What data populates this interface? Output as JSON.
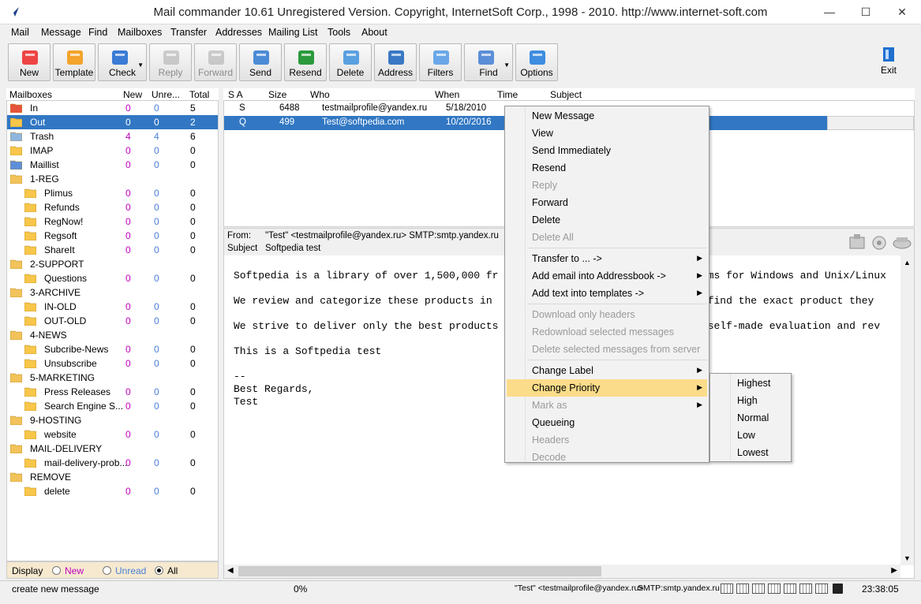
{
  "window": {
    "title": "Mail commander 10.61 Unregistered Version. Copyright, InternetSoft Corp., 1998 - 2010. http://www.internet-soft.com",
    "minimize": "—",
    "maximize": "☐",
    "close": "✕"
  },
  "menu": [
    "Mail",
    "Message",
    "Find",
    "Mailboxes",
    "Transfer",
    "Addresses",
    "Mailing List",
    "Tools",
    "About"
  ],
  "toolbar": [
    {
      "label": "New",
      "icon": "new-icon",
      "enabled": true
    },
    {
      "label": "Template",
      "icon": "template-icon",
      "enabled": true
    },
    {
      "label": "Check",
      "icon": "check-icon",
      "enabled": true
    },
    {
      "label": "Reply",
      "icon": "reply-icon",
      "enabled": false
    },
    {
      "label": "Forward",
      "icon": "forward-icon",
      "enabled": false
    },
    {
      "label": "Send",
      "icon": "send-icon",
      "enabled": true
    },
    {
      "label": "Resend",
      "icon": "resend-icon",
      "enabled": true
    },
    {
      "label": "Delete",
      "icon": "delete-icon",
      "enabled": true
    },
    {
      "label": "Address",
      "icon": "address-icon",
      "enabled": true
    },
    {
      "label": "Filters",
      "icon": "filters-icon",
      "enabled": true
    },
    {
      "label": "Find",
      "icon": "find-icon",
      "enabled": true
    },
    {
      "label": "Options",
      "icon": "options-icon",
      "enabled": true
    }
  ],
  "exit_label": "Exit",
  "mailbox_columns": [
    "Mailboxes",
    "New",
    "Unre...",
    "Total"
  ],
  "mailboxes": [
    {
      "name": "In",
      "new": "0",
      "unread": "0",
      "total": "5",
      "level": 0,
      "type": "in"
    },
    {
      "name": "Out",
      "new": "0",
      "unread": "0",
      "total": "2",
      "level": 0,
      "type": "out",
      "selected": true
    },
    {
      "name": "Trash",
      "new": "4",
      "unread": "4",
      "total": "6",
      "level": 0,
      "type": "trash"
    },
    {
      "name": "IMAP",
      "new": "0",
      "unread": "0",
      "total": "0",
      "level": 0,
      "type": "imap"
    },
    {
      "name": "Maillist",
      "new": "0",
      "unread": "0",
      "total": "0",
      "level": 0,
      "type": "maillist"
    },
    {
      "name": "1-REG",
      "new": "",
      "unread": "",
      "total": "",
      "level": 0,
      "type": "folder"
    },
    {
      "name": "Plimus",
      "new": "0",
      "unread": "0",
      "total": "0",
      "level": 1,
      "type": "box"
    },
    {
      "name": "Refunds",
      "new": "0",
      "unread": "0",
      "total": "0",
      "level": 1,
      "type": "box"
    },
    {
      "name": "RegNow!",
      "new": "0",
      "unread": "0",
      "total": "0",
      "level": 1,
      "type": "box"
    },
    {
      "name": "Regsoft",
      "new": "0",
      "unread": "0",
      "total": "0",
      "level": 1,
      "type": "box"
    },
    {
      "name": "ShareIt",
      "new": "0",
      "unread": "0",
      "total": "0",
      "level": 1,
      "type": "box"
    },
    {
      "name": "2-SUPPORT",
      "new": "",
      "unread": "",
      "total": "",
      "level": 0,
      "type": "folder"
    },
    {
      "name": "Questions",
      "new": "0",
      "unread": "0",
      "total": "0",
      "level": 1,
      "type": "box"
    },
    {
      "name": "3-ARCHIVE",
      "new": "",
      "unread": "",
      "total": "",
      "level": 0,
      "type": "folder"
    },
    {
      "name": "IN-OLD",
      "new": "0",
      "unread": "0",
      "total": "0",
      "level": 1,
      "type": "box"
    },
    {
      "name": "OUT-OLD",
      "new": "0",
      "unread": "0",
      "total": "0",
      "level": 1,
      "type": "box"
    },
    {
      "name": "4-NEWS",
      "new": "",
      "unread": "",
      "total": "",
      "level": 0,
      "type": "folder"
    },
    {
      "name": "Subcribe-News",
      "new": "0",
      "unread": "0",
      "total": "0",
      "level": 1,
      "type": "box"
    },
    {
      "name": "Unsubscribe",
      "new": "0",
      "unread": "0",
      "total": "0",
      "level": 1,
      "type": "box"
    },
    {
      "name": "5-MARKETING",
      "new": "",
      "unread": "",
      "total": "",
      "level": 0,
      "type": "folder"
    },
    {
      "name": "Press Releases",
      "new": "0",
      "unread": "0",
      "total": "0",
      "level": 1,
      "type": "box"
    },
    {
      "name": "Search Engine S...",
      "new": "0",
      "unread": "0",
      "total": "0",
      "level": 1,
      "type": "box"
    },
    {
      "name": "9-HOSTING",
      "new": "",
      "unread": "",
      "total": "",
      "level": 0,
      "type": "folder"
    },
    {
      "name": "website",
      "new": "0",
      "unread": "0",
      "total": "0",
      "level": 1,
      "type": "box"
    },
    {
      "name": "MAIL-DELIVERY",
      "new": "",
      "unread": "",
      "total": "",
      "level": 0,
      "type": "folder"
    },
    {
      "name": "mail-delivery-prob...",
      "new": "0",
      "unread": "0",
      "total": "0",
      "level": 1,
      "type": "box"
    },
    {
      "name": "REMOVE",
      "new": "",
      "unread": "",
      "total": "",
      "level": 0,
      "type": "folder"
    },
    {
      "name": "delete",
      "new": "0",
      "unread": "0",
      "total": "0",
      "level": 1,
      "type": "box"
    }
  ],
  "display": {
    "label": "Display",
    "new": "New",
    "unread": "Unread",
    "all": "All",
    "selected": "all"
  },
  "message_columns": [
    "S A",
    "Size",
    "Who",
    "When",
    "Time",
    "Subject"
  ],
  "messages": [
    {
      "sa": "S",
      "size": "6488",
      "who": "testmailprofile@yandex.ru",
      "when": "5/18/2010",
      "time": "",
      "subject": "",
      "selected": false
    },
    {
      "sa": "Q",
      "size": "499",
      "who": "Test@softpedia.com",
      "when": "10/20/2016",
      "time": "",
      "subject": "",
      "selected": true
    }
  ],
  "preview": {
    "from_label": "From:",
    "from_value": "\"Test\" <testmailprofile@yandex.ru>  SMTP:smtp.yandex.ru",
    "subject_label": "Subject",
    "subject_value": "Softpedia test",
    "body_lines": [
      "Softpedia is a library of over 1,500,000 fr                                 ams for Windows and Unix/Linux",
      "",
      "We review and categorize these products in                                 o find the exact product they",
      "",
      "We strive to deliver only the best products                                h self-made evaluation and rev",
      "",
      "This is a Softpedia test",
      "",
      "--",
      "Best Regards,",
      "Test"
    ]
  },
  "status": {
    "hint": "create new message",
    "progress": "0%",
    "account": "\"Test\" <testmailprofile@yandex.ru>",
    "smtp": "SMTP:smtp.yandex.ru",
    "clock": "23:38:05"
  },
  "context_menu": [
    {
      "label": "New Message",
      "enabled": true
    },
    {
      "label": "View",
      "enabled": true
    },
    {
      "label": "Send Immediately",
      "enabled": true
    },
    {
      "label": "Resend",
      "enabled": true
    },
    {
      "label": "Reply",
      "enabled": false
    },
    {
      "label": "Forward",
      "enabled": true
    },
    {
      "label": "Delete",
      "enabled": true
    },
    {
      "label": "Delete All",
      "enabled": false
    },
    {
      "sep": true
    },
    {
      "label": "Transfer to ... ->",
      "enabled": true,
      "sub": true
    },
    {
      "label": "Add email into Addressbook ->",
      "enabled": true,
      "sub": true
    },
    {
      "label": "Add text into templates ->",
      "enabled": true,
      "sub": true
    },
    {
      "sep": true
    },
    {
      "label": "Download only headers",
      "enabled": false
    },
    {
      "label": "Redownload selected messages",
      "enabled": false
    },
    {
      "label": "Delete selected messages from server",
      "enabled": false
    },
    {
      "sep": true
    },
    {
      "label": "Change Label",
      "enabled": true,
      "sub": true
    },
    {
      "label": "Change Priority",
      "enabled": true,
      "sub": true,
      "highlight": true
    },
    {
      "label": "Mark as",
      "enabled": false,
      "sub": true
    },
    {
      "label": "Queueing",
      "enabled": true
    },
    {
      "label": "Headers",
      "enabled": false
    },
    {
      "label": "Decode",
      "enabled": false
    }
  ],
  "priority_menu": [
    "Highest",
    "High",
    "Normal",
    "Low",
    "Lowest"
  ]
}
